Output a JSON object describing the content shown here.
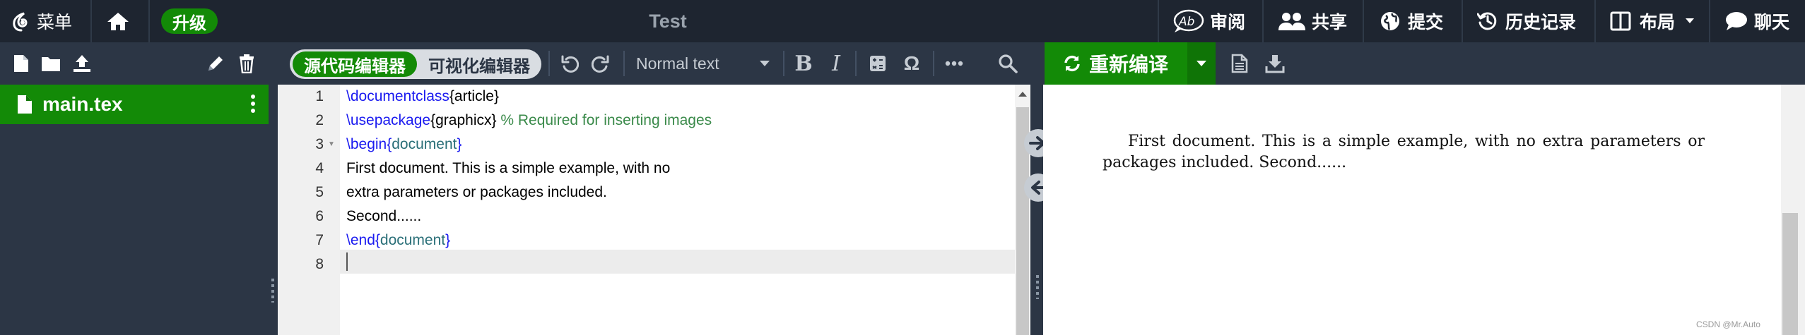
{
  "topbar": {
    "menu_label": "菜单",
    "upgrade_label": "升级",
    "project_title": "Test",
    "review_label": "审阅",
    "share_label": "共享",
    "submit_label": "提交",
    "history_label": "历史记录",
    "layout_label": "布局",
    "chat_label": "聊天"
  },
  "toolbar": {
    "source_editor_label": "源代码编辑器",
    "visual_editor_label": "可视化编辑器",
    "text_style_value": "Normal text",
    "omega_label": "Ω",
    "recompile_label": "重新编译"
  },
  "sidebar": {
    "file_name": "main.tex"
  },
  "editor": {
    "line_numbers": [
      "1",
      "2",
      "3",
      "4",
      "5",
      "6",
      "7",
      "8"
    ],
    "lines": {
      "l1_cmd": "\\documentclass",
      "l1_open": "{",
      "l1_arg": "article",
      "l1_close": "}",
      "l2_cmd": "\\usepackage",
      "l2_open": "{",
      "l2_arg": "graphicx",
      "l2_close": "}",
      "l2_comment": " % Required for inserting images",
      "l3_cmd": "\\begin",
      "l3_open": "{",
      "l3_arg": "document",
      "l3_close": "}",
      "l4": "First document. This is a simple example, with no",
      "l5": "extra parameters or packages included.",
      "l6": "Second......",
      "l7_cmd": "\\end",
      "l7_open": "{",
      "l7_arg": "document",
      "l7_close": "}",
      "l8": ""
    }
  },
  "preview": {
    "text": "First document.  This is a simple example, with no extra parameters or packages included. Second......"
  },
  "watermark": "CSDN @Mr.Auto",
  "colors": {
    "brand_green": "#138a07",
    "topbar_bg": "#1e2530",
    "toolbar_bg": "#2c3645"
  }
}
